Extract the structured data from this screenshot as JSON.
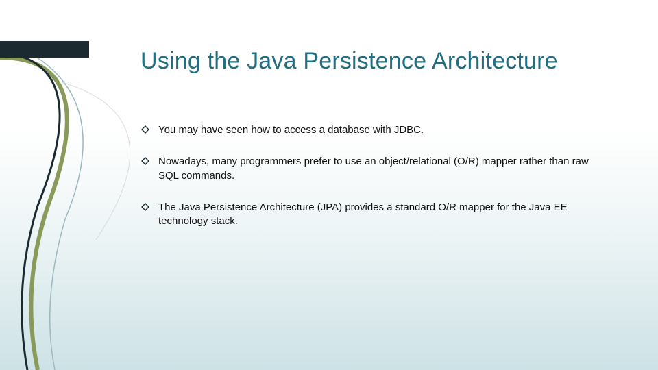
{
  "title": "Using the Java Persistence Architecture",
  "bullets": [
    "You may have seen how to access a database with JDBC.",
    "Nowadays, many programmers prefer to use an object/relational (O/R) mapper rather than raw SQL commands.",
    "The Java Persistence Architecture (JPA) provides a standard O/R mapper for the Java EE technology stack."
  ],
  "colors": {
    "title": "#1f6e82",
    "accent_dark": "#1a2a30",
    "accent_olive": "#8a9a5b"
  }
}
